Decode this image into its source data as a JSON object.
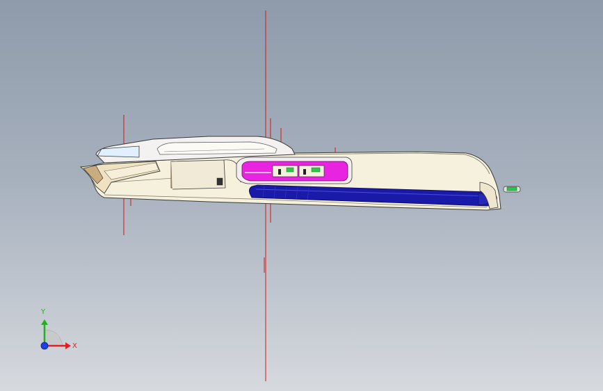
{
  "viewport": {
    "background_top": "#8f9bab",
    "background_bottom": "#d6d9de"
  },
  "model": {
    "body_color": "#f6f1dc",
    "outline_color": "#3a3a3a",
    "window_color": "#e0f0ff",
    "pink_part_color": "#e824e0",
    "blue_part_color": "#1a1aa8",
    "green_part_color": "#2dc84a",
    "reference_line_color": "#d41616",
    "beige_part_color": "#d8b88a"
  },
  "triad": {
    "x_label": "X",
    "y_label": "Y",
    "x_color": "#e02020",
    "y_color": "#20b020",
    "z_color": "#2040e0",
    "x_icon": "x-axis-arrow-icon",
    "y_icon": "y-axis-arrow-icon",
    "z_icon": "z-axis-origin-icon"
  }
}
